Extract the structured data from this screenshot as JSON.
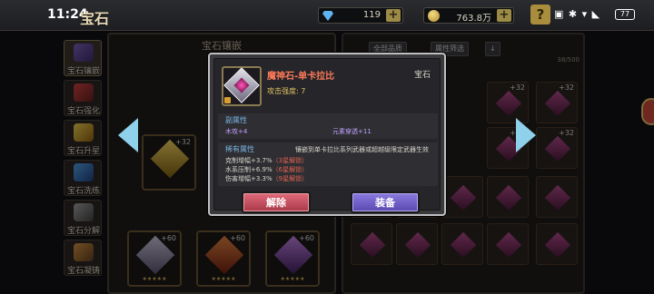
{
  "status_bar": {
    "time": "11:24",
    "battery": "77"
  },
  "header": {
    "title": "宝石",
    "resources": [
      {
        "name": "gem",
        "value": "119"
      },
      {
        "name": "gold",
        "value": "763.8万"
      }
    ],
    "help_label": "?"
  },
  "sidebar": {
    "items": [
      {
        "label": "宝石镶嵌"
      },
      {
        "label": "宝石强化"
      },
      {
        "label": "宝石升星"
      },
      {
        "label": "宝石洗练"
      },
      {
        "label": "宝石分解"
      },
      {
        "label": "宝石凝铸"
      }
    ]
  },
  "left_panel": {
    "title": "宝石镶嵌",
    "slot_level": "+60",
    "mid_level": "+32"
  },
  "right_panel": {
    "filter_all": "全部品质",
    "filter_attr": "属性筛选",
    "count": "38/500",
    "cell_level": "+32"
  },
  "modal": {
    "item_name": "魔神石-单卡拉比",
    "item_type": "宝石",
    "attack": "攻击强度: 7",
    "secondary_title": "副属性",
    "secondary": [
      {
        "text": "木攻+4"
      },
      {
        "text": "元素穿透+11"
      }
    ],
    "rare_title": "稀有属性",
    "rare_desc": "镶嵌到单卡拉比系列武器或超越级限定武器生效",
    "rare_lines": [
      {
        "text": "克制增幅+3.7%",
        "note": "（3星解锁）"
      },
      {
        "text": "水系压制+6.9%",
        "note": "（6星解锁）"
      },
      {
        "text": "伤害增幅+3.3%",
        "note": "（9星解锁）"
      }
    ],
    "remove_label": "解除",
    "equip_label": "装备"
  }
}
